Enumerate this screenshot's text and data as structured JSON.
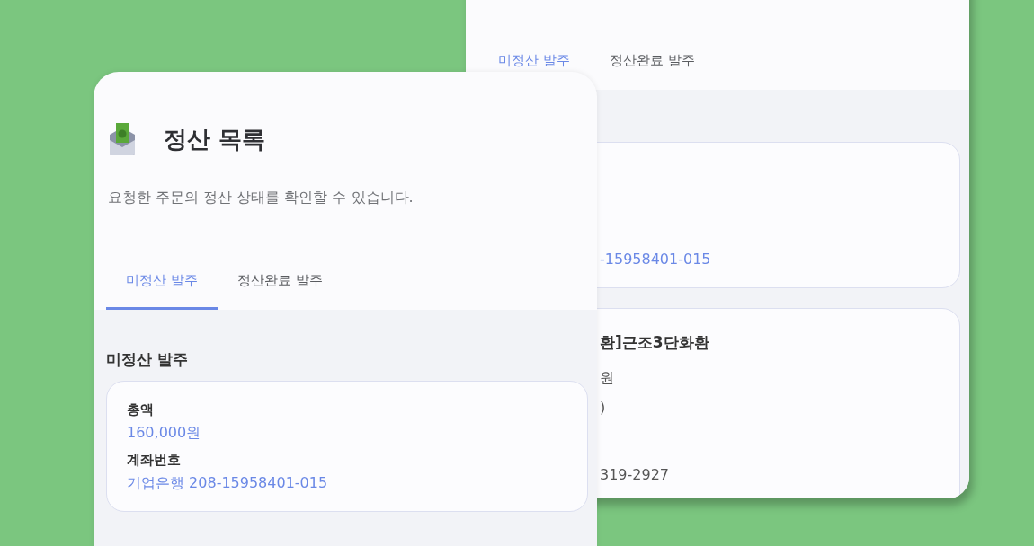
{
  "back_screen": {
    "tabs": [
      {
        "label": "미정산 발주",
        "selected": true
      },
      {
        "label": "정산완료 발주",
        "selected": false
      }
    ],
    "cards": [
      {
        "lines": [
          {
            "kind": "value",
            "text": "-15958401-015"
          }
        ]
      },
      {
        "lines": [
          {
            "kind": "title",
            "text": "환]근조3단화환"
          },
          {
            "kind": "text",
            "text": "원"
          },
          {
            "kind": "text",
            "text": ")"
          },
          {
            "kind": "text",
            "text": "319-2927"
          }
        ]
      }
    ]
  },
  "front_screen": {
    "title": "정산 목록",
    "description": "요청한 주문의 정산 상태를 확인할 수 있습니다.",
    "tabs": [
      {
        "label": "미정산 발주",
        "selected": true
      },
      {
        "label": "정산완료 발주",
        "selected": false
      }
    ],
    "section_title": "미정산 발주",
    "cards": [
      {
        "fields": [
          {
            "label": "총액",
            "value": "160,000원"
          },
          {
            "label": "계좌번호",
            "value": "기업은행 208-15958401-015"
          }
        ]
      }
    ]
  }
}
